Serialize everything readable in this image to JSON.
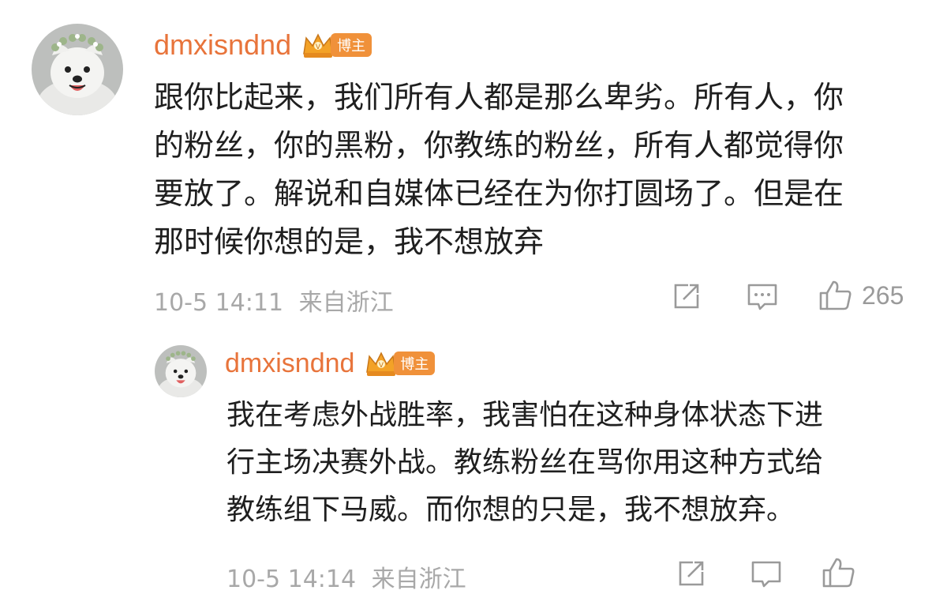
{
  "colors": {
    "username": "#e8743b",
    "badge": "#f0913a",
    "meta": "#a8a8a8",
    "icons": "#9a9a9a"
  },
  "comment": {
    "avatar_icon": "samoyed-dog-avatar",
    "username": "dmxisndnd",
    "badge": {
      "icon": "crown-icon",
      "label": "博主"
    },
    "lines": [
      "跟你比起来，我们所有人都是那么卑劣。所有人，你",
      "的粉丝，你的黑粉，你教练的粉丝，所有人都觉得你",
      "要放了。解说和自媒体已经在为你打圆场了。但是在",
      "那时候你想的是，我不想放弃"
    ],
    "timestamp": "10-5 14:11",
    "location": "来自浙江",
    "actions": {
      "share_icon": "share-icon",
      "comment_icon": "comment-icon",
      "like_icon": "thumbs-up-icon",
      "like_count": "265"
    }
  },
  "reply": {
    "avatar_icon": "samoyed-dog-avatar",
    "username": "dmxisndnd",
    "badge": {
      "icon": "crown-icon",
      "label": "博主"
    },
    "lines": [
      "我在考虑外战胜率，我害怕在这种身体状态下进",
      "行主场决赛外战。教练粉丝在骂你用这种方式给",
      "教练组下马威。而你想的只是，我不想放弃。"
    ],
    "timestamp": "10-5 14:14",
    "location": "来自浙江"
  }
}
